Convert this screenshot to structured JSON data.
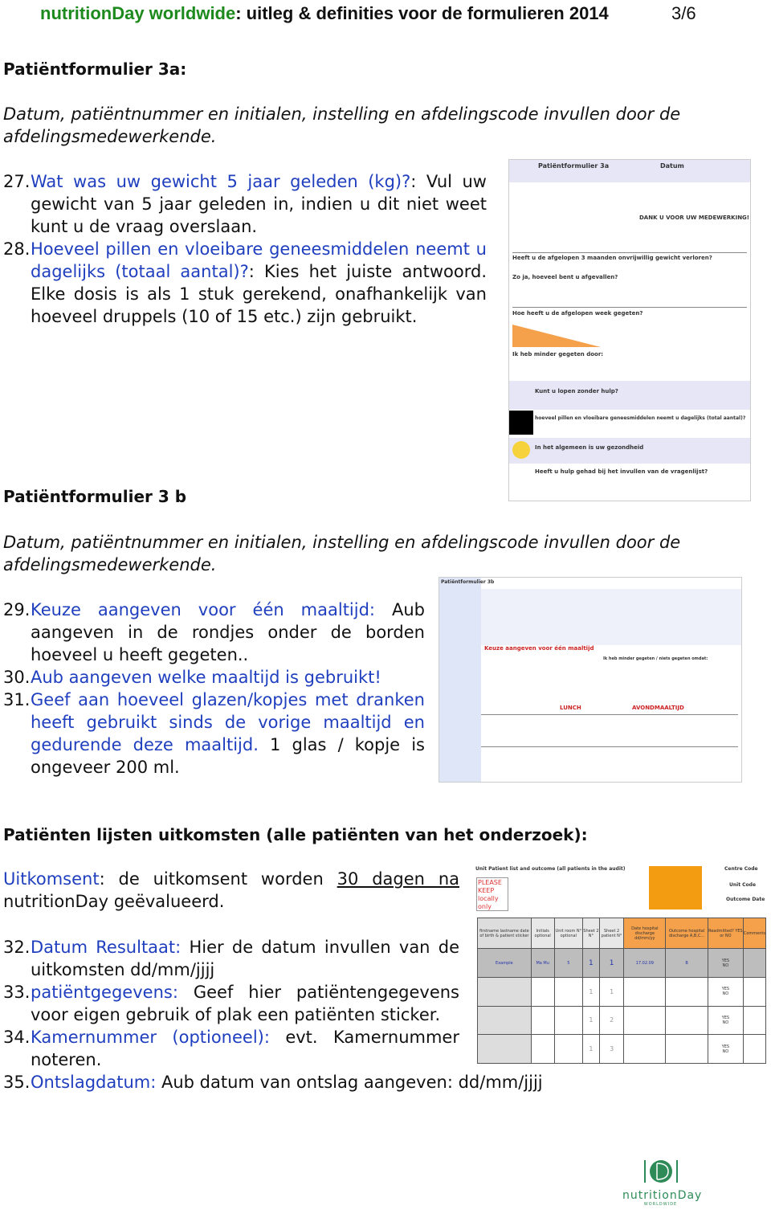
{
  "header": {
    "brand": "nutritionDay worldwide",
    "title": ": uitleg & definities voor de formulieren 2014",
    "page": "3/6"
  },
  "section3a": {
    "heading": "Patiëntformulier 3a:",
    "intro": "Datum, patiëntnummer en initialen, instelling en afdelingscode invullen door de afdelingsmedewerkende.",
    "items": [
      {
        "num": "27.",
        "link": "Wat was uw gewicht 5 jaar geleden (kg)?",
        "text": ": Vul uw gewicht van 5 jaar geleden in, indien u dit niet weet kunt u de vraag overslaan."
      },
      {
        "num": "28.",
        "link": "Hoeveel pillen en vloeibare geneesmiddelen neemt u dagelijks (totaal aantal)?",
        "text": ": Kies het juiste antwoord. Elke dosis is als 1 stuk gerekend, onafhankelijk van hoeveel druppels (10 of 15 etc.) zijn gebruikt."
      }
    ],
    "form": {
      "title": "Patiëntformulier 3a",
      "datum": "Datum",
      "thanks": "DANK U VOOR UW MEDEWERKING!",
      "q1": "Heeft u de afgelopen 3 maanden onvrijwillig gewicht verloren?",
      "q2": "Zo ja, hoeveel bent u afgevallen?",
      "q3": "Hoe heeft u de afgelopen week gegeten?",
      "q4": "Ik heb minder gegeten door:",
      "q5": "Kunt u lopen zonder hulp?",
      "q6": "hoeveel pillen en vloeibare geneesmiddelen neemt u dagelijks (total aantal)?",
      "q7": "In het algemeen is uw gezondheid",
      "q8": "Heeft u hulp gehad bij het invullen van de vragenlijst?"
    }
  },
  "section3b": {
    "heading": "Patiëntformulier 3 b",
    "intro": "Datum, patiëntnummer en initialen, instelling en afdelingscode invullen door de afdelingsmedewerkende.",
    "items": [
      {
        "num": "29.",
        "link": "Keuze aangeven voor één maaltijd:",
        "text": " Aub aangeven in de rondjes onder de borden hoeveel u heeft gegeten.."
      },
      {
        "num": "30.",
        "link": "Aub aangeven welke maaltijd is gebruikt!",
        "text": ""
      },
      {
        "num": "31.",
        "link": "Geef aan hoeveel glazen/kopjes met dranken heeft gebruikt sinds de vorige maaltijd en gedurende deze maaltijd.",
        "text": " 1 glas / kopje is ongeveer 200 ml."
      }
    ],
    "form": {
      "title": "Patiëntformulier 3b",
      "q1": "Keuze aangeven voor één maaltijd",
      "q2": "Ik heb minder gegeten / niets gegeten omdat:",
      "lunch": "LUNCH",
      "dinner": "AVONDMAALTIJD"
    }
  },
  "outcomes": {
    "heading": "Patiënten lijsten uitkomsten (alle patiënten van het onderzoek):",
    "intro_link": "Uitkomsent",
    "intro_text": ": de uitkomsent worden ",
    "intro_underline": "30 dagen na",
    "intro_end": " nutritionDay geëvalueerd.",
    "items": [
      {
        "num": "32.",
        "link": "Datum Resultaat:",
        "text": " Hier de datum invullen van de uitkomsten dd/mm/jjjj"
      },
      {
        "num": "33.",
        "link": "patiëntgegevens:",
        "text": " Geef hier patiëntengegevens voor eigen gebruik of plak een patiënten sticker."
      },
      {
        "num": "34.",
        "link": "Kamernummer (optioneel):",
        "text": " evt. Kamernummer noteren."
      },
      {
        "num": "35.",
        "link": "Ontslagdatum:",
        "text": " Aub datum van ontslag aangeven: dd/mm/jjjj"
      }
    ],
    "form": {
      "title": "Unit Patient list and outcome (all patients in the audit)",
      "keep": "PLEASE KEEP locally only",
      "centre": "Centre Code",
      "unit": "Unit Code",
      "outcome_date": "Outcome Date",
      "cols": [
        "firstname lastname date of birth & patient sticker",
        "Initials optional",
        "Unit room N° optional",
        "Sheet 2 N°",
        "Sheet 2 patient N°",
        "Date hospital discharge dd/mm/yy",
        "Outcome hospital discharge A,B,C...",
        "Readmitted? YES or NO",
        "Comments"
      ],
      "example": {
        "label": "Example",
        "initials": "Ma Mu",
        "room": "5",
        "sheet": "1",
        "patient": "1",
        "date": "17.02.09",
        "outcome": "B"
      },
      "rows": [
        [
          "1",
          "1"
        ],
        [
          "1",
          "2"
        ],
        [
          "1",
          "3"
        ]
      ],
      "yes": "YES",
      "no": "NO"
    }
  },
  "logo": {
    "text": "nutritionDay",
    "sub": "WORLDWIDE",
    "color": "#2e8b57"
  },
  "colors": {
    "brand_green": "#1d8a1d",
    "link_blue": "#1f3fbf",
    "orange": "#f5a04a"
  }
}
